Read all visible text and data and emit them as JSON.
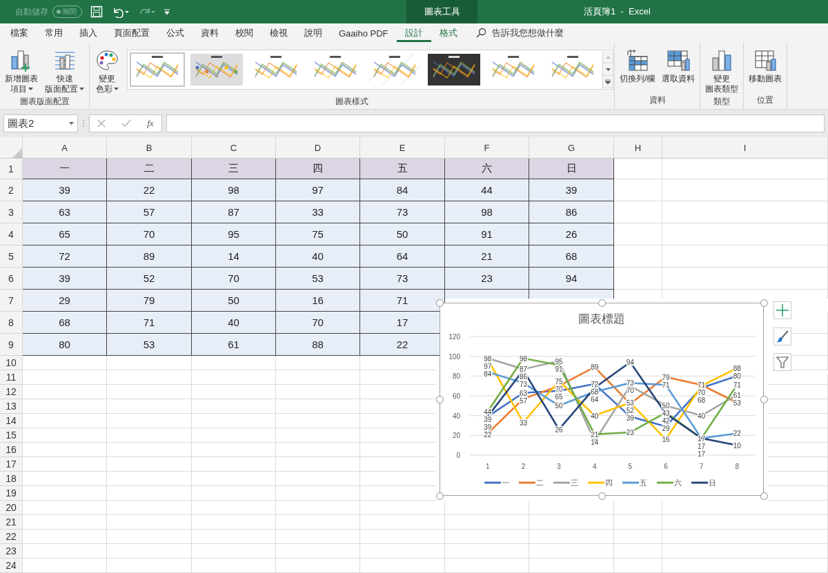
{
  "title_bar": {
    "autosave_label": "自動儲存",
    "autosave_state": "關閉",
    "autosave_on": false,
    "context_tab": "圖表工具",
    "window_title": "活頁簿1  -  Excel"
  },
  "menu_tabs": [
    {
      "label": "檔案",
      "kind": "normal",
      "selected": false
    },
    {
      "label": "常用",
      "kind": "normal",
      "selected": false
    },
    {
      "label": "插入",
      "kind": "normal",
      "selected": false
    },
    {
      "label": "頁面配置",
      "kind": "normal",
      "selected": false
    },
    {
      "label": "公式",
      "kind": "normal",
      "selected": false
    },
    {
      "label": "資料",
      "kind": "normal",
      "selected": false
    },
    {
      "label": "校閱",
      "kind": "normal",
      "selected": false
    },
    {
      "label": "檢視",
      "kind": "normal",
      "selected": false
    },
    {
      "label": "說明",
      "kind": "normal",
      "selected": false
    },
    {
      "label": "Gaaiho PDF",
      "kind": "normal",
      "selected": false
    },
    {
      "label": "設計",
      "kind": "context",
      "selected": true
    },
    {
      "label": "格式",
      "kind": "context",
      "selected": false
    }
  ],
  "tell_me": "告訴我您想做什麼",
  "ribbon": {
    "groups": [
      {
        "label": "圖表版面配置",
        "buttons": [
          {
            "lines": [
              "新增圖表",
              "項目"
            ],
            "dropdown": true
          },
          {
            "lines": [
              "快速",
              "版面配置"
            ],
            "dropdown": true
          }
        ]
      },
      {
        "label": "圖表樣式",
        "buttons": [
          {
            "lines": [
              "變更",
              "色彩"
            ],
            "dropdown": true
          }
        ],
        "styles": [
          {
            "kind": "plain",
            "selected": true
          },
          {
            "kind": "gray",
            "selected": false
          },
          {
            "kind": "plain",
            "selected": false
          },
          {
            "kind": "plain",
            "selected": false
          },
          {
            "kind": "hatched",
            "selected": false
          },
          {
            "kind": "dark",
            "selected": false
          },
          {
            "kind": "plain",
            "selected": false
          },
          {
            "kind": "plain",
            "selected": false
          }
        ]
      },
      {
        "label": "資料",
        "buttons": [
          {
            "lines": [
              "切換列/欄"
            ],
            "dropdown": false
          },
          {
            "lines": [
              "選取資料"
            ],
            "dropdown": false
          }
        ]
      },
      {
        "label": "類型",
        "buttons": [
          {
            "lines": [
              "變更",
              "圖表類型"
            ],
            "dropdown": false
          }
        ]
      },
      {
        "label": "位置",
        "buttons": [
          {
            "lines": [
              "移動圖表"
            ],
            "dropdown": false
          }
        ]
      }
    ]
  },
  "formula_bar": {
    "name_box": "圖表2",
    "fx": "fx"
  },
  "sheet": {
    "columns": [
      "A",
      "B",
      "C",
      "D",
      "E",
      "F",
      "G",
      "H",
      "I"
    ],
    "row_numbers": [
      "1",
      "2",
      "3",
      "4",
      "5",
      "6",
      "7",
      "8",
      "9",
      "10",
      "11",
      "12",
      "13",
      "14",
      "15",
      "16",
      "17",
      "18",
      "19",
      "20",
      "21",
      "22",
      "23",
      "24"
    ],
    "header_row": [
      "一",
      "二",
      "三",
      "四",
      "五",
      "六",
      "日"
    ],
    "rows": [
      [
        "39",
        "22",
        "98",
        "97",
        "84",
        "44",
        "39"
      ],
      [
        "63",
        "57",
        "87",
        "33",
        "73",
        "98",
        "86"
      ],
      [
        "65",
        "70",
        "95",
        "75",
        "50",
        "91",
        "26"
      ],
      [
        "72",
        "89",
        "14",
        "40",
        "64",
        "21",
        "68"
      ],
      [
        "39",
        "52",
        "70",
        "53",
        "73",
        "23",
        "94"
      ],
      [
        "29",
        "79",
        "50",
        "16",
        "71"
      ],
      [
        "68",
        "71",
        "40",
        "70",
        "17"
      ],
      [
        "80",
        "53",
        "61",
        "88",
        "22"
      ]
    ]
  },
  "chart": {
    "chart_data": {
      "type": "line",
      "title": "圖表標題",
      "categories": [
        "1",
        "2",
        "3",
        "4",
        "5",
        "6",
        "7",
        "8"
      ],
      "ylim": [
        0,
        120
      ],
      "yticks": [
        0,
        20,
        40,
        60,
        80,
        100,
        120
      ],
      "data_labels": true,
      "grid": true,
      "legend": "bottom",
      "series": [
        {
          "name": "一",
          "color": "#4472c4",
          "values": [
            39,
            63,
            65,
            72,
            39,
            29,
            68,
            80
          ]
        },
        {
          "name": "二",
          "color": "#ed7d31",
          "values": [
            22,
            57,
            70,
            89,
            52,
            79,
            71,
            53
          ]
        },
        {
          "name": "三",
          "color": "#a5a5a5",
          "values": [
            98,
            87,
            95,
            14,
            70,
            50,
            40,
            61
          ]
        },
        {
          "name": "四",
          "color": "#ffc000",
          "values": [
            97,
            33,
            75,
            40,
            53,
            16,
            70,
            88
          ]
        },
        {
          "name": "五",
          "color": "#5b9bd5",
          "values": [
            84,
            73,
            50,
            64,
            73,
            71,
            17,
            22
          ]
        },
        {
          "name": "六",
          "color": "#70ad47",
          "values": [
            44,
            98,
            91,
            21,
            23,
            43,
            17,
            71
          ]
        },
        {
          "name": "日",
          "color": "#264478",
          "values": [
            39,
            86,
            26,
            68,
            94,
            42,
            17,
            10
          ]
        }
      ]
    }
  }
}
